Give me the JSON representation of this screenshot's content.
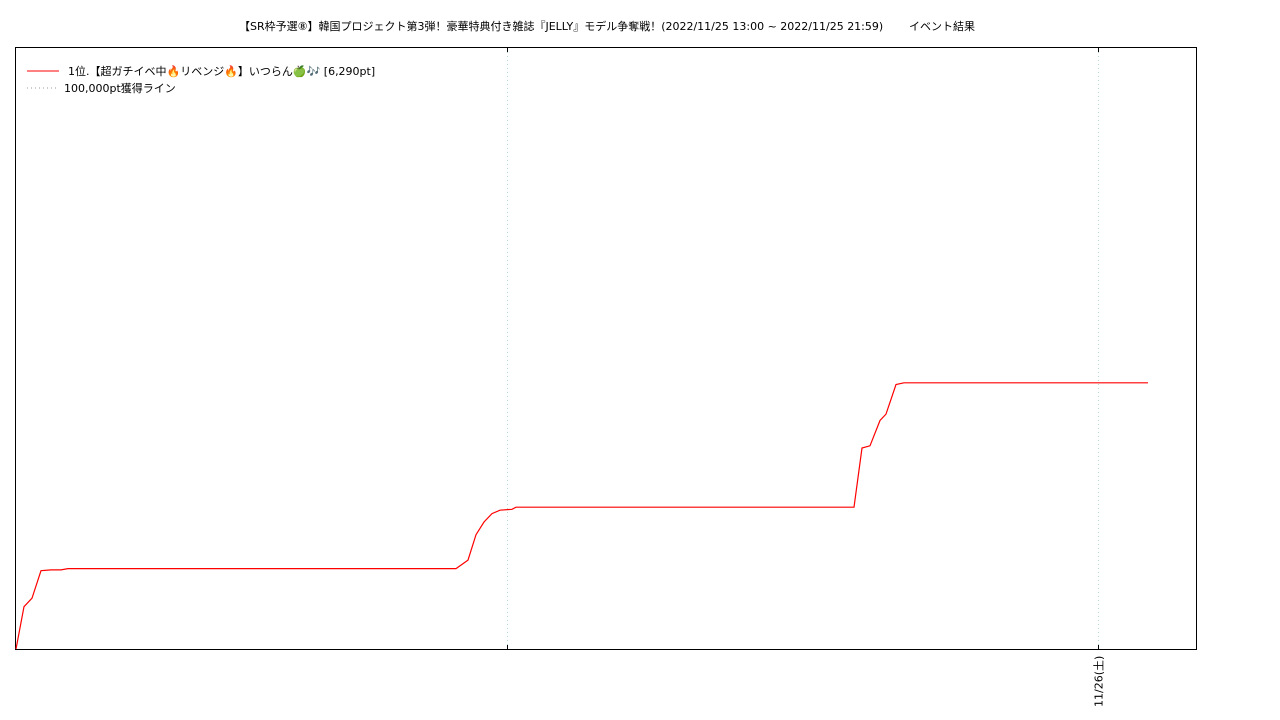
{
  "chart_data": {
    "type": "line",
    "title": "【SR枠予選⑧】韓国プロジェクト第3弾！豪華特典付き雑誌『JELLY』モデル争奪戦！(2022/11/25 13:00 ~ 2022/11/25 21:59)",
    "title_suffix": "イベント結果",
    "xlabel": "",
    "ylabel": "",
    "grid": "vertical dotted",
    "legend_placement": "top-left",
    "x_tick_labels": [
      "",
      "11/26(土)"
    ],
    "series": [
      {
        "name": "1位.【超ガチイベ中🔥リベンジ🔥】いつらん🍏🎶 [6,290pt]",
        "color": "#ff0000",
        "style": "solid",
        "points": [
          [
            0,
            0
          ],
          [
            8,
            1000
          ],
          [
            16,
            1200
          ],
          [
            25,
            1850
          ],
          [
            35,
            1870
          ],
          [
            45,
            1870
          ],
          [
            52,
            1900
          ],
          [
            350,
            1900
          ],
          [
            440,
            1900
          ],
          [
            452,
            2100
          ],
          [
            460,
            2700
          ],
          [
            468,
            3000
          ],
          [
            476,
            3200
          ],
          [
            484,
            3280
          ],
          [
            496,
            3300
          ],
          [
            500,
            3350
          ],
          [
            838,
            3350
          ],
          [
            846,
            4750
          ],
          [
            854,
            4800
          ],
          [
            864,
            5400
          ],
          [
            870,
            5550
          ],
          [
            880,
            6250
          ],
          [
            888,
            6290
          ],
          [
            1132,
            6290
          ]
        ]
      },
      {
        "name": "100,000pt獲得ライン",
        "color": "#999999",
        "style": "dotted",
        "points": []
      }
    ],
    "colors": {
      "primary_line": "#ff0000",
      "reference_line": "#999999",
      "grid": "#b0d8d8",
      "frame": "#000000"
    }
  }
}
